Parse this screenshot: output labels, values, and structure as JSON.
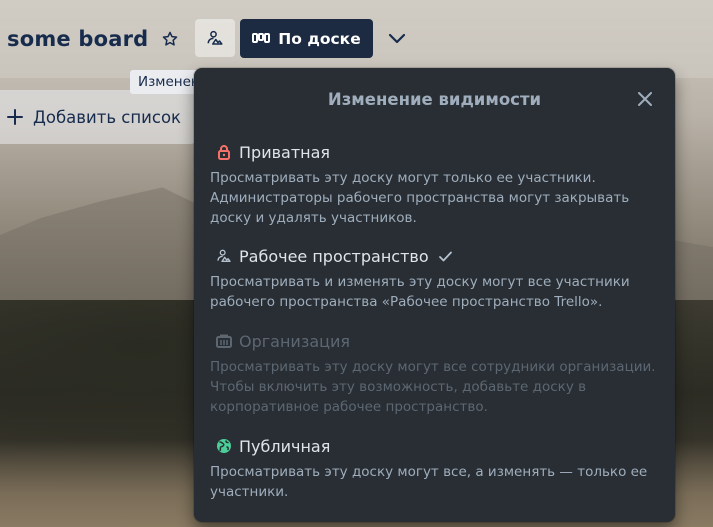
{
  "board": {
    "title": "some board",
    "view_button_label": "По доске"
  },
  "tooltip": {
    "text": "Изменение видимости"
  },
  "add_list": {
    "label": "Добавить список"
  },
  "popover": {
    "title": "Изменение видимости",
    "options": [
      {
        "label": "Приватная",
        "description": "Просматривать эту доску могут только ее участники. Администраторы рабочего пространства могут закрывать доску и удалять участников.",
        "icon": "lock-icon",
        "icon_color": "#f87168",
        "selected": false,
        "disabled": false
      },
      {
        "label": "Рабочее пространство",
        "description": "Просматривать и изменять эту доску могут все участники рабочего пространства «Рабочее пространство Trello».",
        "icon": "workspace-members-icon",
        "icon_color": "#b6c2cf",
        "selected": true,
        "disabled": false
      },
      {
        "label": "Организация",
        "description": "Просматривать эту доску могут все сотрудники организации. Чтобы включить эту возможность, добавьте доску в корпоративное рабочее пространство.",
        "icon": "organization-icon",
        "icon_color": "#5d6772",
        "selected": false,
        "disabled": true
      },
      {
        "label": "Публичная",
        "description": "Просматривать эту доску могут все, а изменять — только ее участники.",
        "icon": "globe-icon",
        "icon_color": "#4bce97",
        "selected": false,
        "disabled": false
      }
    ]
  },
  "colors": {
    "popover_bg": "#282e33",
    "view_button_bg": "#1c2b41",
    "text_primary": "#dee4ea",
    "text_secondary": "#9fadbc",
    "text_disabled": "#5d6772"
  }
}
